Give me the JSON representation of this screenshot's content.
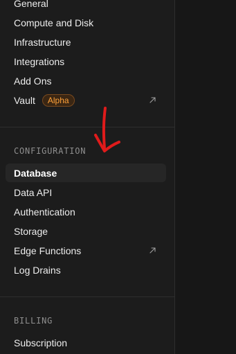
{
  "sidebar": {
    "top_items": [
      {
        "label": "General"
      },
      {
        "label": "Compute and Disk"
      },
      {
        "label": "Infrastructure"
      },
      {
        "label": "Integrations"
      },
      {
        "label": "Add Ons"
      },
      {
        "label": "Vault",
        "badge": "Alpha",
        "icon": "external-link-icon"
      }
    ],
    "configuration": {
      "heading": "CONFIGURATION",
      "items": [
        {
          "label": "Database",
          "active": true
        },
        {
          "label": "Data API"
        },
        {
          "label": "Authentication"
        },
        {
          "label": "Storage"
        },
        {
          "label": "Edge Functions",
          "icon": "external-link-icon"
        },
        {
          "label": "Log Drains"
        }
      ]
    },
    "billing": {
      "heading": "BILLING",
      "items": [
        {
          "label": "Subscription"
        }
      ]
    }
  },
  "colors": {
    "background": "#1c1c1c",
    "active_item_bg": "#262626",
    "badge_text": "#ffa23a",
    "annotation_arrow": "#e01b1b"
  }
}
